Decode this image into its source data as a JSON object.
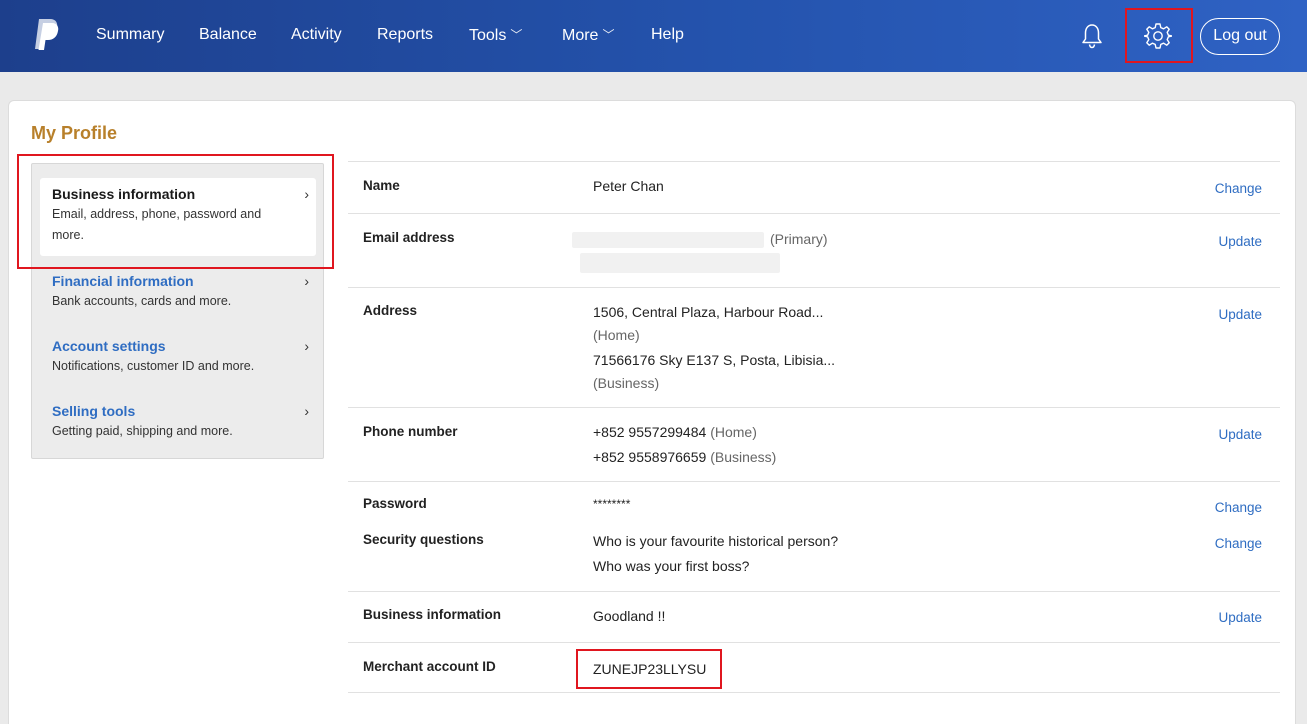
{
  "nav": {
    "items": [
      {
        "label": "Summary"
      },
      {
        "label": "Balance"
      },
      {
        "label": "Activity"
      },
      {
        "label": "Reports"
      },
      {
        "label": "Tools",
        "has_dropdown": true
      },
      {
        "label": "More",
        "has_dropdown": true
      },
      {
        "label": "Help"
      }
    ],
    "logout_label": "Log out",
    "icons": [
      "paypal-logo",
      "bell-icon",
      "gear-icon"
    ],
    "brand_color": "#2453ad"
  },
  "page": {
    "title": "My Profile"
  },
  "sidebar": {
    "items": [
      {
        "title": "Business information",
        "desc": "Email, address, phone, password and more.",
        "active": true
      },
      {
        "title": "Financial information",
        "desc": "Bank accounts, cards and more."
      },
      {
        "title": "Account settings",
        "desc": "Notifications, customer ID and more."
      },
      {
        "title": "Selling tools",
        "desc": "Getting paid, shipping and more."
      }
    ],
    "chevron": "›"
  },
  "profile": {
    "name": {
      "label": "Name",
      "value": "Peter Chan",
      "action": "Change"
    },
    "email": {
      "label": "Email address",
      "primary_tag": "(Primary)",
      "action": "Update"
    },
    "address": {
      "label": "Address",
      "line1": "1506, Central Plaza, Harbour Road...",
      "tag1": "(Home)",
      "line2": "71566176 Sky E137 S, Posta, Libisia...",
      "tag2": "(Business)",
      "action": "Update"
    },
    "phone": {
      "label": "Phone number",
      "num1": "+852 9557299484",
      "tag1": "(Home)",
      "num2": "+852 9558976659",
      "tag2": "(Business)",
      "action": "Update"
    },
    "password": {
      "label": "Password",
      "value": "********",
      "action": "Change"
    },
    "security": {
      "label": "Security questions",
      "q1": "Who is your favourite historical person?",
      "q2": "Who was your first boss?",
      "action": "Change"
    },
    "business": {
      "label": "Business information",
      "value": "Goodland !!",
      "action": "Update"
    },
    "merchant": {
      "label": "Merchant account ID",
      "value": "ZUNEJP23LLYSU"
    }
  }
}
